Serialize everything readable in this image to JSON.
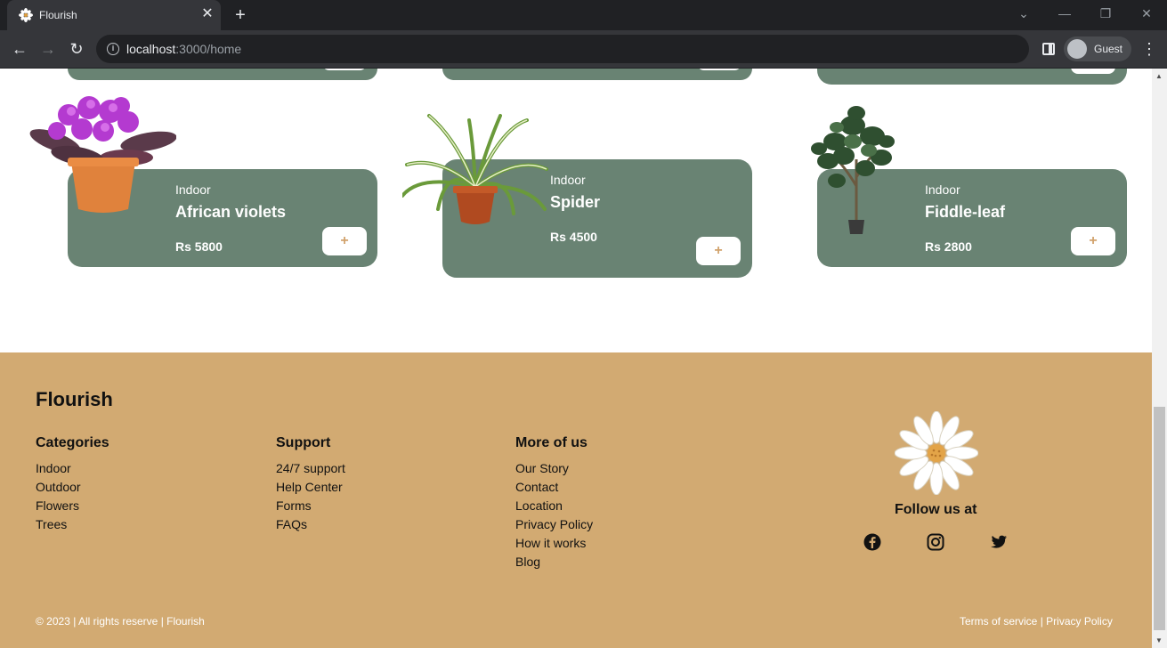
{
  "browser": {
    "tab_title": "Flourish",
    "url_host": "localhost",
    "url_rest": ":3000/home",
    "profile_name": "Guest"
  },
  "products": [
    {
      "category": "Indoor",
      "name": "African violets",
      "price": "Rs 5800",
      "add_label": "+"
    },
    {
      "category": "Indoor",
      "name": "Spider",
      "price": "Rs 4500",
      "add_label": "+"
    },
    {
      "category": "Indoor",
      "name": "Fiddle-leaf",
      "price": "Rs 2800",
      "add_label": "+"
    }
  ],
  "footer": {
    "brand": "Flourish",
    "columns": [
      {
        "title": "Categories",
        "links": [
          "Indoor",
          "Outdoor",
          "Flowers",
          "Trees"
        ]
      },
      {
        "title": "Support",
        "links": [
          "24/7 support",
          "Help Center",
          "Forms",
          "FAQs"
        ]
      },
      {
        "title": "More of us",
        "links": [
          "Our Story",
          "Contact",
          "Location",
          "Privacy Policy",
          "How it works",
          "Blog"
        ]
      }
    ],
    "follow_label": "Follow us at",
    "copyright": "© 2023 | All rights reserve | Flourish",
    "legal": {
      "terms": "Terms of service",
      "separator": " | ",
      "privacy": "Privacy Policy"
    }
  },
  "colors": {
    "card_bg": "#698373",
    "footer_bg": "#d2aa72",
    "accent": "#d2a26c"
  },
  "icons": [
    "flower-favicon-icon",
    "facebook-icon",
    "instagram-icon",
    "twitter-icon"
  ]
}
